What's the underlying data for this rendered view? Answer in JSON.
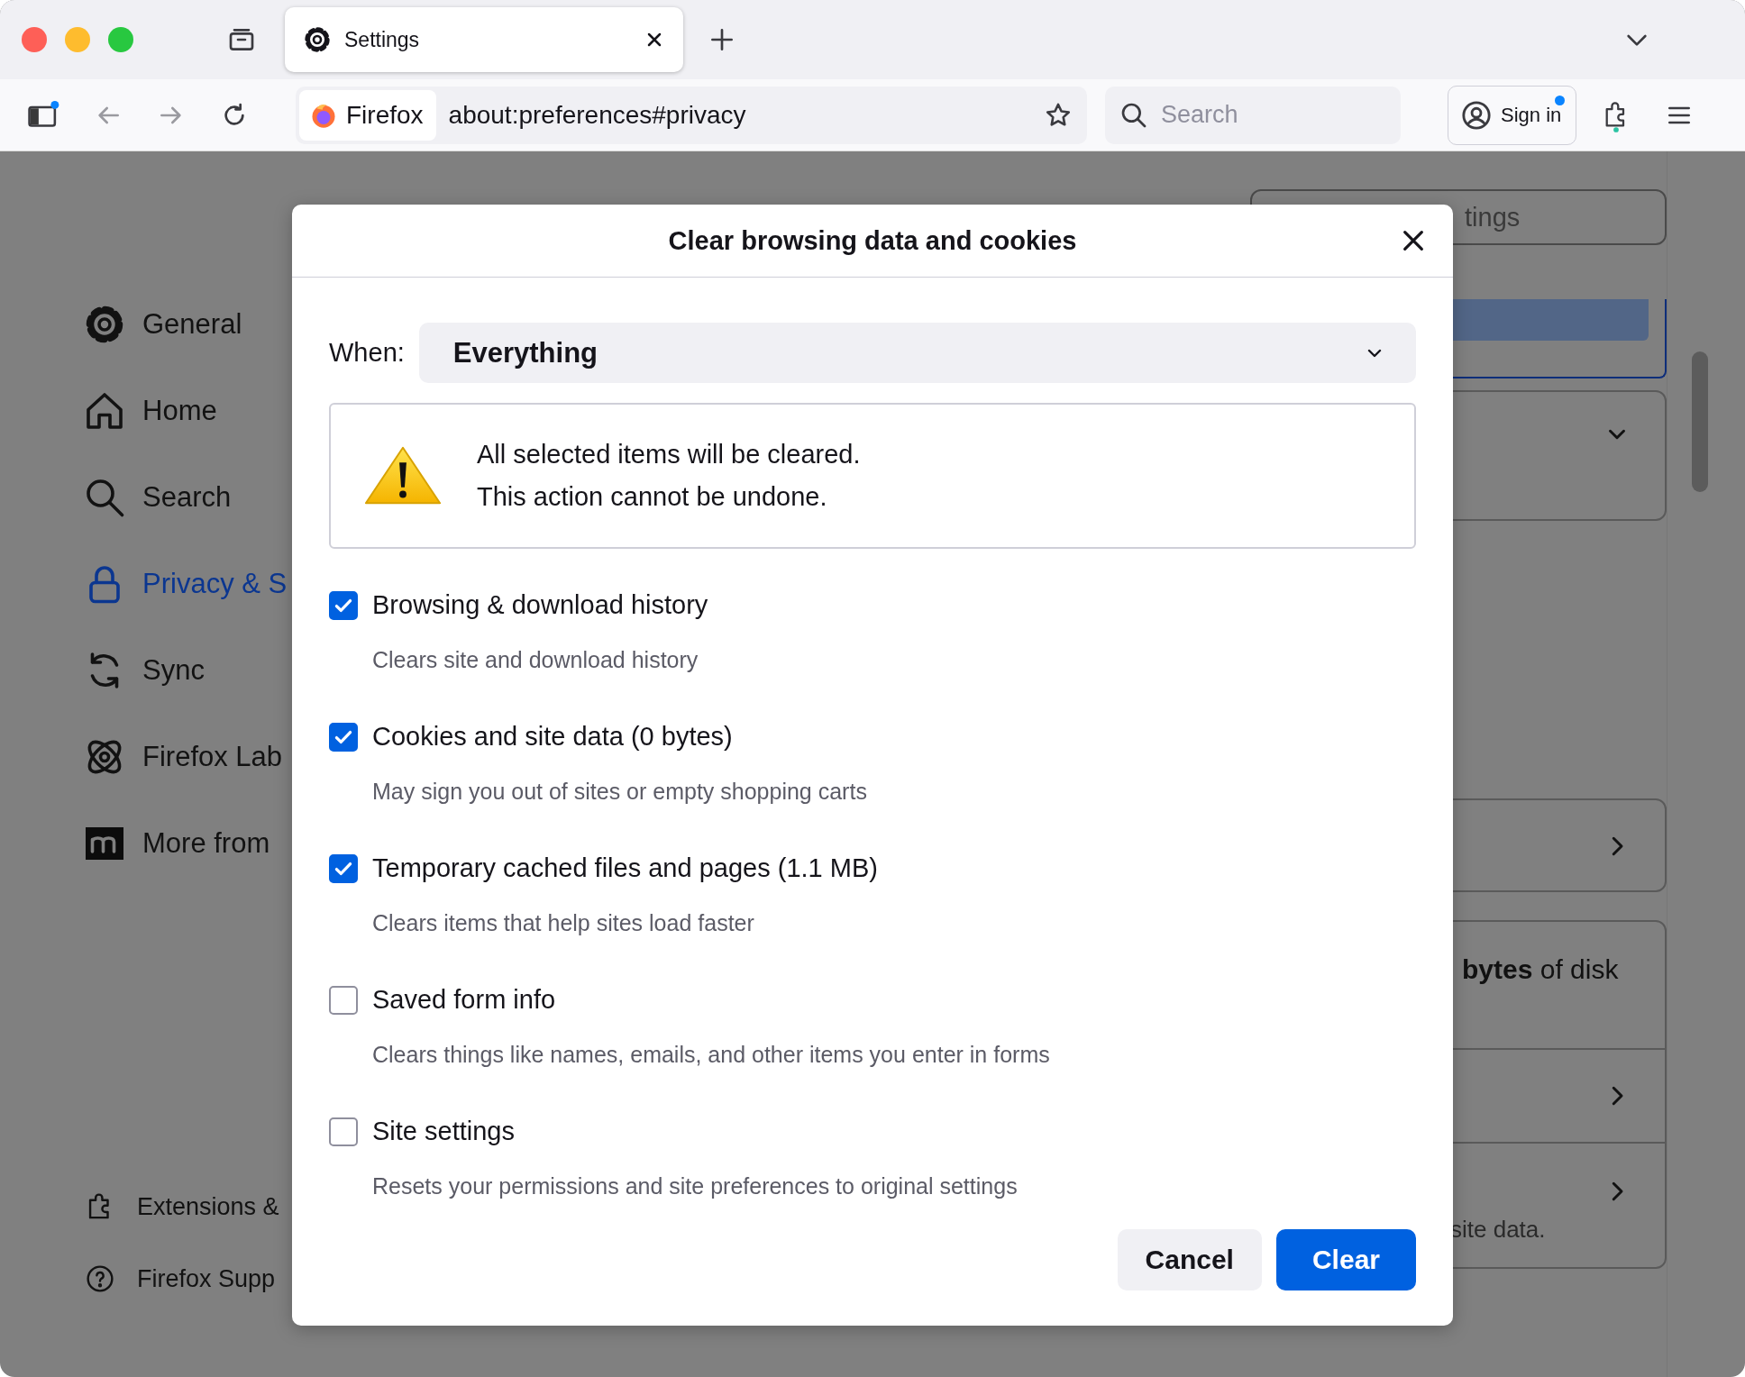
{
  "tabs": [
    {
      "label": "Settings",
      "selected": true
    }
  ],
  "toolbar": {
    "identity": "Firefox",
    "url": "about:preferences#privacy",
    "search": {
      "placeholder": "Search"
    },
    "sign_in": "Sign in"
  },
  "sidebar": {
    "items": [
      {
        "label": "General",
        "selected": false
      },
      {
        "label": "Home",
        "selected": false
      },
      {
        "label": "Search",
        "selected": false
      },
      {
        "label": "Privacy & S",
        "selected": true
      },
      {
        "label": "Sync",
        "selected": false
      },
      {
        "label": "Firefox Lab",
        "selected": false
      },
      {
        "label": "More from",
        "selected": false
      }
    ],
    "footer": [
      {
        "label": "Extensions &"
      },
      {
        "label": "Firefox Supp"
      }
    ]
  },
  "background": {
    "search_field": "tings",
    "storage_text": "**bytes** of disk",
    "site_data_text": "site data."
  },
  "dialog": {
    "title": "Clear browsing data and cookies",
    "when_label": "When:",
    "when_value": "Everything",
    "warning": [
      "All selected items will be cleared.",
      "This action cannot be undone."
    ],
    "options": [
      {
        "label": "Browsing & download history",
        "description": "Clears site and download history",
        "checked": true
      },
      {
        "label": "Cookies and site data (0 bytes)",
        "description": "May sign you out of sites or empty shopping carts",
        "checked": true
      },
      {
        "label": "Temporary cached files and pages (1.1 MB)",
        "description": "Clears items that help sites load faster",
        "checked": true
      },
      {
        "label": "Saved form info",
        "description": "Clears things like names, emails, and other items you enter in forms",
        "checked": false
      },
      {
        "label": "Site settings",
        "description": "Resets your permissions and site preferences to original settings",
        "checked": false
      }
    ],
    "buttons": [
      {
        "label": "Cancel",
        "kind": "secondary"
      },
      {
        "label": "Clear",
        "kind": "primary"
      }
    ]
  }
}
